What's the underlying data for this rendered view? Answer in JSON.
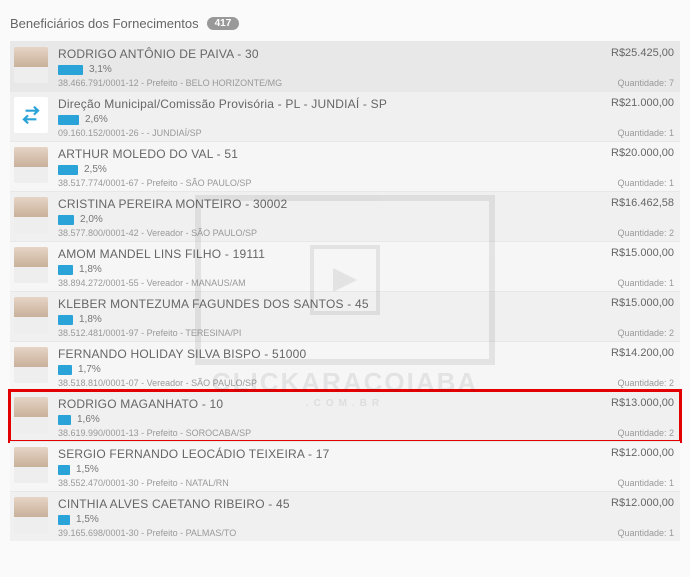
{
  "header": {
    "title": "Beneficiários dos Fornecimentos",
    "count": "417"
  },
  "qty_prefix": "Quantidade: ",
  "watermark": {
    "line1": "CLICKARACOIABA",
    "line2": ".COM.BR"
  },
  "items": [
    {
      "name": "RODRIGO ANTÔNIO DE PAIVA - 30",
      "percent": "3,1%",
      "bar": 25,
      "meta": "38.466.791/0001-12 - Prefeito - BELO HORIZONTE/MG",
      "amount": "R$25.425,00",
      "qty": "7",
      "avatar": "person",
      "selected": true,
      "highlighted": false
    },
    {
      "name": "Direção Municipal/Comissão Provisória - PL - JUNDIAÍ - SP",
      "percent": "2,6%",
      "bar": 21,
      "meta": "09.160.152/0001-26 - - JUNDIAÍ/SP",
      "amount": "R$21.000,00",
      "qty": "1",
      "avatar": "swap",
      "selected": false,
      "highlighted": false
    },
    {
      "name": "ARTHUR MOLEDO DO VAL - 51",
      "percent": "2,5%",
      "bar": 20,
      "meta": "38.517.774/0001-67 - Prefeito - SÃO PAULO/SP",
      "amount": "R$20.000,00",
      "qty": "1",
      "avatar": "person",
      "selected": false,
      "highlighted": false
    },
    {
      "name": "CRISTINA PEREIRA MONTEIRO - 30002",
      "percent": "2,0%",
      "bar": 16,
      "meta": "38.577.800/0001-42 - Vereador - SÃO PAULO/SP",
      "amount": "R$16.462,58",
      "qty": "2",
      "avatar": "person",
      "selected": false,
      "highlighted": false
    },
    {
      "name": "AMOM MANDEL LINS FILHO - 19111",
      "percent": "1,8%",
      "bar": 15,
      "meta": "38.894.272/0001-55 - Vereador - MANAUS/AM",
      "amount": "R$15.000,00",
      "qty": "1",
      "avatar": "person",
      "selected": false,
      "highlighted": false
    },
    {
      "name": "KLEBER MONTEZUMA FAGUNDES DOS SANTOS - 45",
      "percent": "1,8%",
      "bar": 15,
      "meta": "38.512.481/0001-97 - Prefeito - TERESINA/PI",
      "amount": "R$15.000,00",
      "qty": "2",
      "avatar": "person",
      "selected": false,
      "highlighted": false
    },
    {
      "name": "FERNANDO HOLIDAY SILVA BISPO - 51000",
      "percent": "1,7%",
      "bar": 14,
      "meta": "38.518.810/0001-07 - Vereador - SÃO PAULO/SP",
      "amount": "R$14.200,00",
      "qty": "2",
      "avatar": "person",
      "selected": false,
      "highlighted": false
    },
    {
      "name": "RODRIGO MAGANHATO - 10",
      "percent": "1,6%",
      "bar": 13,
      "meta": "38.619.990/0001-13 - Prefeito - SOROCABA/SP",
      "amount": "R$13.000,00",
      "qty": "2",
      "avatar": "person",
      "selected": false,
      "highlighted": true
    },
    {
      "name": "SERGIO FERNANDO LEOCÁDIO TEIXEIRA - 17",
      "percent": "1,5%",
      "bar": 12,
      "meta": "38.552.470/0001-30 - Prefeito - NATAL/RN",
      "amount": "R$12.000,00",
      "qty": "1",
      "avatar": "person",
      "selected": false,
      "highlighted": false
    },
    {
      "name": "CINTHIA ALVES CAETANO RIBEIRO - 45",
      "percent": "1,5%",
      "bar": 12,
      "meta": "39.165.698/0001-30 - Prefeito - PALMAS/TO",
      "amount": "R$12.000,00",
      "qty": "1",
      "avatar": "person",
      "selected": false,
      "highlighted": false
    }
  ]
}
